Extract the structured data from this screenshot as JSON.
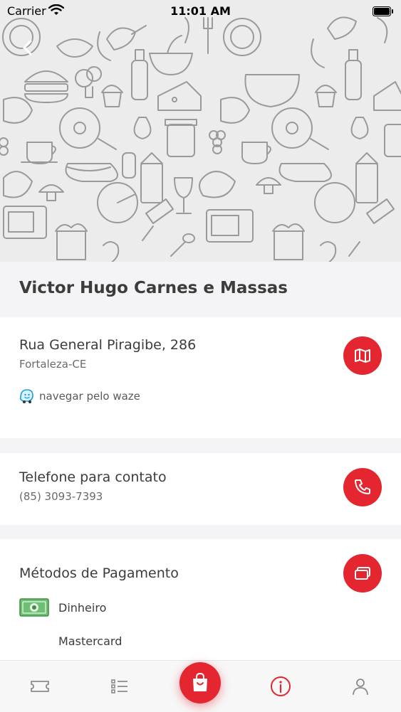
{
  "status_bar": {
    "carrier": "Carrier",
    "time": "11:01 AM"
  },
  "restaurant": {
    "name": "Victor Hugo Carnes e Massas"
  },
  "address": {
    "street": "Rua General Piragibe, 286",
    "city": "Fortaleza-CE",
    "waze_label": "navegar pelo waze",
    "map_button_icon": "map-icon"
  },
  "contact": {
    "title": "Telefone para contato",
    "phone": "(85) 3093-7393",
    "phone_button_icon": "phone-icon"
  },
  "payment": {
    "title": "Métodos de Pagamento",
    "button_icon": "credit-card-icon",
    "methods": [
      {
        "label": "Dinheiro",
        "icon": "money-icon"
      },
      {
        "label": "Mastercard",
        "icon": ""
      }
    ]
  },
  "tabbar": {
    "tabs": [
      {
        "icon": "ticket-icon"
      },
      {
        "icon": "list-icon"
      },
      {
        "icon": "shopping-bag-icon"
      },
      {
        "icon": "info-icon"
      },
      {
        "icon": "user-icon"
      }
    ],
    "active_color": "#e3262f",
    "inactive_color": "#8a8a8a"
  },
  "colors": {
    "accent": "#e3262f",
    "background": "#f4f4f6"
  }
}
